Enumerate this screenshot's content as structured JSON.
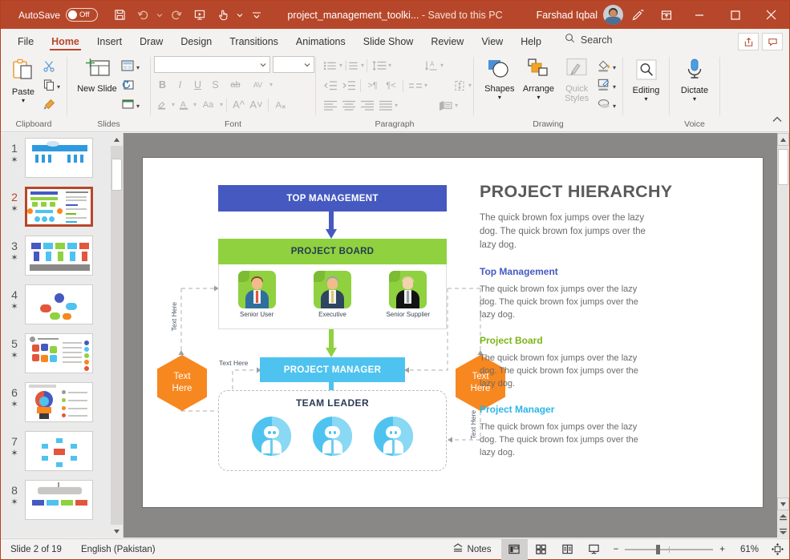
{
  "titlebar": {
    "autosave_label": "AutoSave",
    "autosave_state": "Off",
    "doc_title": "project_management_toolki...",
    "saved_state": "-  Saved to this PC",
    "user_name": "Farshad Iqbal",
    "icons": [
      "save-icon",
      "undo-icon",
      "undo-dropdown",
      "redo-icon",
      "present-icon",
      "touch-mode-icon",
      "touch-dropdown",
      "qat-dropdown"
    ],
    "window_controls": [
      "minimize",
      "maximize",
      "close"
    ],
    "accent_color": "#b7472a"
  },
  "ribbon": {
    "tabs": [
      {
        "label": "File",
        "active": false
      },
      {
        "label": "Home",
        "active": true
      },
      {
        "label": "Insert",
        "active": false
      },
      {
        "label": "Draw",
        "active": false
      },
      {
        "label": "Design",
        "active": false
      },
      {
        "label": "Transitions",
        "active": false
      },
      {
        "label": "Animations",
        "active": false
      },
      {
        "label": "Slide Show",
        "active": false
      },
      {
        "label": "Review",
        "active": false
      },
      {
        "label": "View",
        "active": false
      },
      {
        "label": "Help",
        "active": false
      }
    ],
    "search_label": "Search",
    "share_button": "share-icon",
    "comments_button": "comments-icon",
    "groups": [
      {
        "name": "Clipboard"
      },
      {
        "name": "Slides"
      },
      {
        "name": "Font"
      },
      {
        "name": "Paragraph"
      },
      {
        "name": "Drawing"
      },
      {
        "name": "Voice"
      }
    ],
    "clipboard": {
      "paste_label": "Paste",
      "cut_icon": "scissors-icon",
      "copy_icon": "copy-icon",
      "format_painter_icon": "format-painter-icon"
    },
    "slides": {
      "new_slide_label": "New Slide",
      "layout_icon": "layout-icon",
      "reset_icon": "reset-icon",
      "section_icon": "section-icon"
    },
    "font": {
      "font_name_value": "",
      "font_size_value": "",
      "bold": "B",
      "italic": "I",
      "underline": "U",
      "shadow": "S",
      "strikethrough": "ab",
      "spacing": "AV",
      "highlight_icon": "text-highlight-icon",
      "color_icon": "font-color-icon",
      "change_case": "Aa",
      "grow_font": "A",
      "shrink_font": "A",
      "clear_format_icon": "clear-formatting-icon"
    },
    "drawing": {
      "shapes_label": "Shapes",
      "arrange_label": "Arrange",
      "quick_styles_label": "Quick Styles",
      "fill_icon": "shape-fill-icon",
      "outline_icon": "shape-outline-icon",
      "effects_icon": "shape-effects-icon"
    },
    "editing": {
      "label": "Editing",
      "icon": "magnifier-icon"
    },
    "voice": {
      "label": "Dictate",
      "icon": "microphone-icon"
    },
    "collapse_icon": "collapse-ribbon-icon"
  },
  "thumbnails": {
    "items": [
      {
        "number": "1",
        "star": "✶",
        "selected": false
      },
      {
        "number": "2",
        "star": "✶",
        "selected": true
      },
      {
        "number": "3",
        "star": "✶",
        "selected": false
      },
      {
        "number": "4",
        "star": "✶",
        "selected": false
      },
      {
        "number": "5",
        "star": "✶",
        "selected": false
      },
      {
        "number": "6",
        "star": "✶",
        "selected": false
      },
      {
        "number": "7",
        "star": "✶",
        "selected": false
      },
      {
        "number": "8",
        "star": "✶",
        "selected": false
      }
    ]
  },
  "slide": {
    "diagram": {
      "top_management": "TOP MANAGEMENT",
      "project_board": "PROJECT BOARD",
      "board_members": [
        {
          "caption": "Senior User",
          "hair": "#8a4b2a",
          "skin": "#f0bc8c",
          "suit": "#2f6f9e",
          "tie": "#e2563c"
        },
        {
          "caption": "Executive",
          "hair": "#9aa2ab",
          "skin": "#f0bc8c",
          "suit": "#2f4560",
          "tie": "#d9c66a"
        },
        {
          "caption": "Senior Supplier",
          "hair": "#e2c9a8",
          "skin": "#f3d3ae",
          "suit": "#131313",
          "tie": "#9aa2ab"
        }
      ],
      "project_manager": "PROJECT MANAGER",
      "team_leader": "TEAM LEADER",
      "team_member_count": 3,
      "hex_left": [
        "Text",
        "Here"
      ],
      "hex_right": [
        "Text",
        "Here"
      ],
      "label_left_vertical": "Text Here",
      "label_mid": "Text Here",
      "label_right_vertical": "Text Here",
      "colors": {
        "top_management": "#4559c0",
        "project_board": "#8fd13f",
        "project_manager": "#4ec3ef",
        "hexagon": "#f7871f",
        "team_member": "#4ec3ef"
      }
    },
    "text_panel": {
      "title": "PROJECT HIERARCHY",
      "intro": "The quick brown fox jumps over the lazy dog. The quick brown fox jumps over the lazy dog.",
      "sections": [
        {
          "heading": "Top Management",
          "color": "#4559c0",
          "body": "The quick brown fox jumps over the lazy dog. The quick brown fox jumps over the lazy dog."
        },
        {
          "heading": "Project Board",
          "color": "#7cb518",
          "body": "The quick brown fox jumps over the lazy dog. The quick brown fox jumps over the lazy dog."
        },
        {
          "heading": "Project Manager",
          "color": "#29b6e8",
          "body": "The quick brown fox jumps over the lazy dog. The quick brown fox jumps over the lazy dog."
        }
      ]
    }
  },
  "statusbar": {
    "slide_count": "Slide 2 of 19",
    "language": "English (Pakistan)",
    "notes_label": "Notes",
    "views": [
      {
        "name": "normal-view",
        "active": true
      },
      {
        "name": "slide-sorter-view",
        "active": false
      },
      {
        "name": "reading-view",
        "active": false
      },
      {
        "name": "slide-show-view",
        "active": false
      }
    ],
    "zoom_out": "−",
    "zoom_in": "+",
    "zoom_level": "61%",
    "fit_icon": "fit-to-window-icon"
  }
}
